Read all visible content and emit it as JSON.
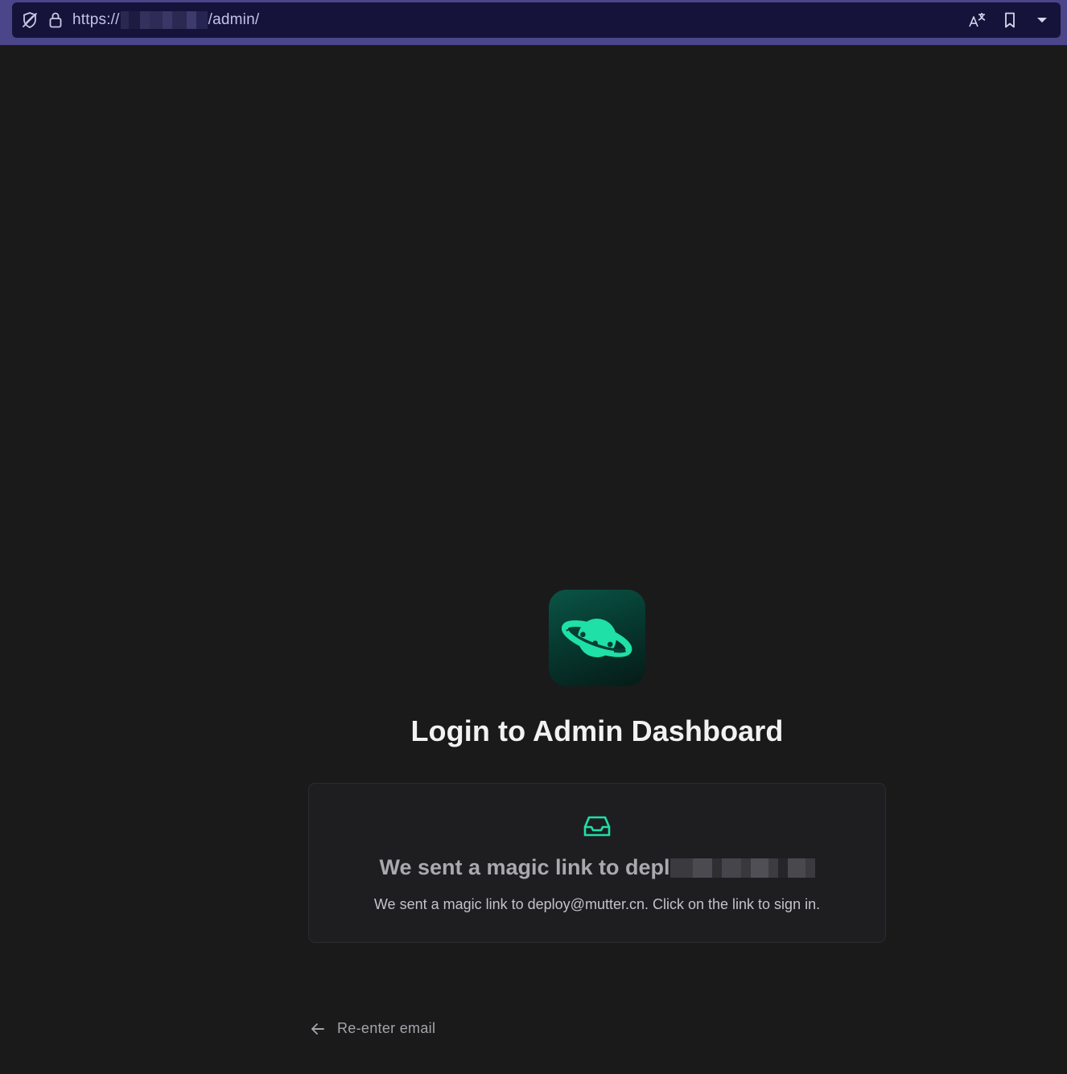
{
  "browser": {
    "url_prefix": "https://",
    "url_suffix": "/admin/",
    "icons": [
      "tracking-protection-icon",
      "lock-icon",
      "translate-icon",
      "bookmark-icon",
      "chevron-down-icon"
    ]
  },
  "logo": {
    "icon": "planet-icon",
    "accent": "#1fe0a6"
  },
  "page": {
    "title": "Login to Admin Dashboard"
  },
  "card": {
    "icon": "inbox-icon",
    "heading_visible": "We sent a magic link to depl",
    "body": "We sent a magic link to deploy@mutter.cn. Click on the link to sign in."
  },
  "back_link": {
    "label": "Re-enter email",
    "icon": "arrow-left-icon"
  },
  "colors": {
    "background": "#1a1a1b",
    "card": "#1e1e21",
    "accent": "#1fe0a6",
    "browser_chrome": "#4b4589",
    "urlbar": "#15133a"
  }
}
